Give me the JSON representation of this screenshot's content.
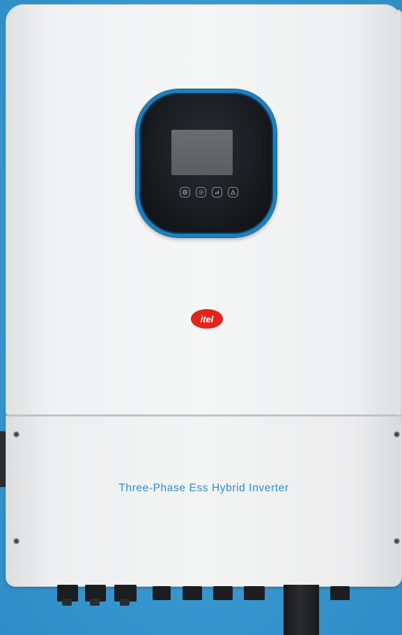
{
  "product": {
    "brand": "itel",
    "cover_label": "Three-Phase Ess Hybrid Inverter"
  },
  "display": {
    "buttons": [
      {
        "icon": "globe-icon"
      },
      {
        "icon": "settings-icon"
      },
      {
        "icon": "signal-icon"
      },
      {
        "icon": "warning-icon"
      }
    ]
  },
  "colors": {
    "background": "#3a9bd2",
    "accent_blue": "#2a8fcf",
    "brand_red": "#e3241b"
  }
}
